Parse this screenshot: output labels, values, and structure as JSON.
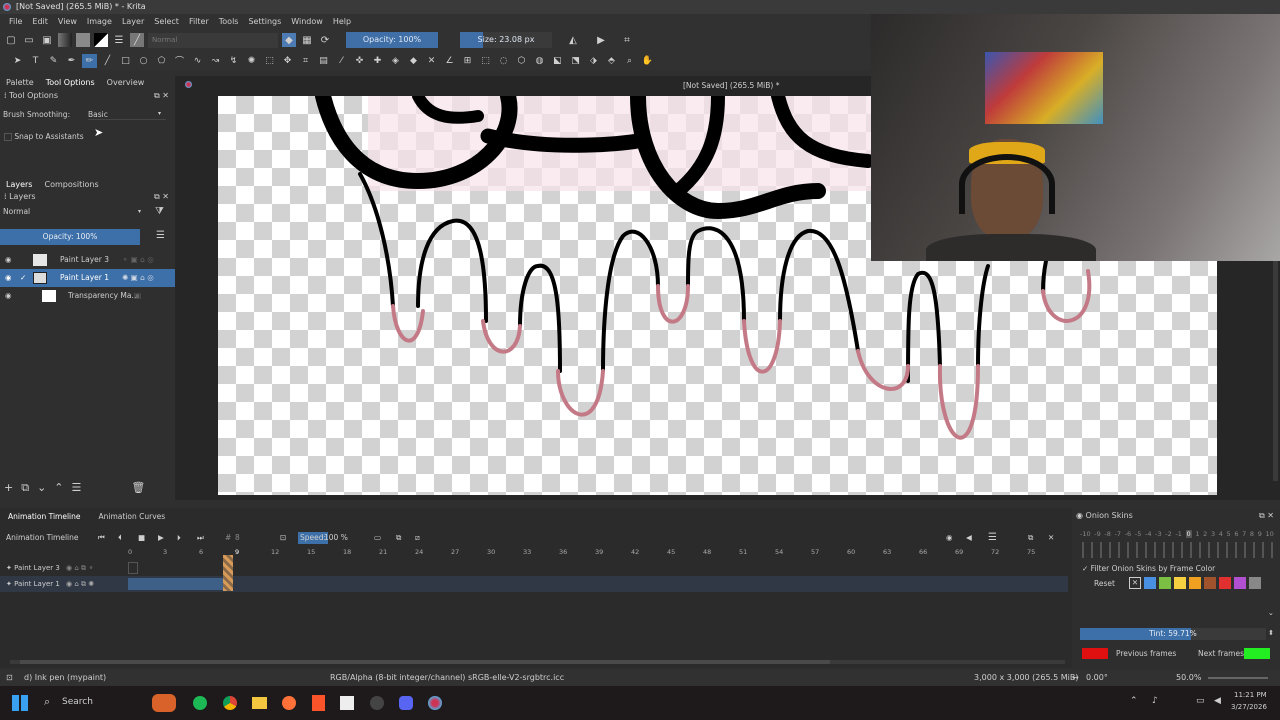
{
  "window": {
    "title": "[Not Saved]  (265.5 MiB) * - Krita"
  },
  "menu": [
    "File",
    "Edit",
    "View",
    "Image",
    "Layer",
    "Select",
    "Filter",
    "Tools",
    "Settings",
    "Window",
    "Help"
  ],
  "toolbar": {
    "blend_mode": "Normal",
    "opacity": "Opacity: 100%",
    "size": "Size: 23.08 px"
  },
  "left_dock": {
    "tabs": [
      "Palette",
      "Tool Options",
      "Overview"
    ],
    "tool_options_title": "Tool Options",
    "brush_smoothing_label": "Brush Smoothing:",
    "brush_smoothing_value": "Basic",
    "snap_label": "Snap to Assistants"
  },
  "layers_dock": {
    "tabs": [
      "Layers",
      "Compositions"
    ],
    "title": "Layers",
    "blend_mode": "Normal",
    "opacity": "Opacity:  100%",
    "layers": [
      {
        "name": "Paint Layer 3",
        "selected": false
      },
      {
        "name": "Paint Layer 1",
        "selected": true
      },
      {
        "name": "Transparency Ma...",
        "selected": false
      }
    ]
  },
  "canvas": {
    "title": "[Not Saved]  (265.5 MiB) *"
  },
  "timeline": {
    "tabs": [
      "Animation Timeline",
      "Animation Curves"
    ],
    "title": "Animation Timeline",
    "frame": "8",
    "speed_label": "Speed:",
    "speed": "100 %",
    "ruler": [
      "0",
      "3",
      "6",
      "9",
      "12",
      "15",
      "18",
      "21",
      "24",
      "27",
      "30",
      "33",
      "36",
      "39",
      "42",
      "45",
      "48",
      "51",
      "54",
      "57",
      "60",
      "63",
      "66",
      "69",
      "72",
      "75"
    ],
    "rows": [
      "Paint Layer 3",
      "Paint Layer 1"
    ]
  },
  "onion": {
    "title": "Onion Skins",
    "numbers": [
      "-10",
      "-9",
      "-8",
      "-7",
      "-6",
      "-5",
      "-4",
      "-3",
      "-2",
      "-1",
      "0",
      "1",
      "2",
      "3",
      "4",
      "5",
      "6",
      "7",
      "8",
      "9",
      "10"
    ],
    "filter_label": "Filter Onion Skins by Frame Color",
    "reset": "Reset",
    "tint": "Tint: 59.71%",
    "tint_value": 0.5971,
    "previous": "Previous frames",
    "next": "Next frames",
    "previous_color": "#e01010",
    "next_color": "#22ee22"
  },
  "status": {
    "brush": "d) Ink pen (mypaint)",
    "color_space": "RGB/Alpha (8-bit integer/channel)  sRGB-elle-V2-srgbtrc.icc",
    "dims": "3,000 x 3,000 (265.5 MiB)",
    "rotation": "0.00°",
    "zoom": "50.0%"
  },
  "taskbar": {
    "search": "Search",
    "time": "11:21 PM",
    "date": "3/27/2026"
  },
  "colors": {
    "selection": "#3d6fa8",
    "drip_outline": "#000000",
    "drip_tip": "#c47a86"
  }
}
